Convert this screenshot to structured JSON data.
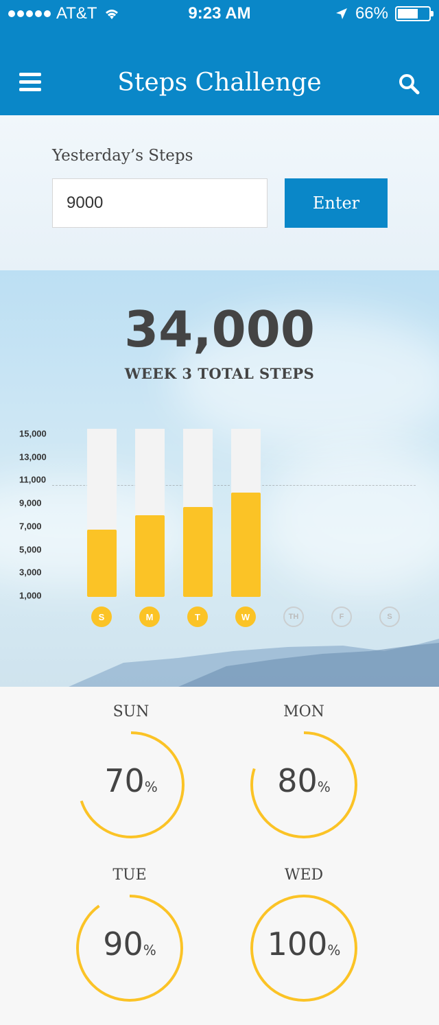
{
  "status_bar": {
    "carrier": "AT&T",
    "time": "9:23 AM",
    "battery": "66%",
    "battery_level": 0.66
  },
  "header": {
    "title": "Steps Challenge",
    "menu_icon": "hamburger-menu-icon",
    "search_icon": "search-icon"
  },
  "entry": {
    "label": "Yesterday’s Steps",
    "value": "9000",
    "button": "Enter"
  },
  "summary": {
    "total": "34,000",
    "caption": "WEEK 3 TOTAL STEPS"
  },
  "chart_data": {
    "type": "bar",
    "y_ticks": [
      "15,000",
      "13,000",
      "11,000",
      "9,000",
      "7,000",
      "5,000",
      "3,000",
      "1,000"
    ],
    "ylim": [
      0,
      15000
    ],
    "goal": 10000,
    "categories": [
      "S",
      "M",
      "T",
      "W",
      "TH",
      "F",
      "S"
    ],
    "values": [
      6000,
      7300,
      8000,
      9300,
      null,
      null,
      null
    ],
    "bar_color": "#fbc326",
    "track_color": "#f3f3f3"
  },
  "daily_progress": [
    {
      "day": "SUN",
      "percent": 70,
      "label": "70",
      "symbol": "%"
    },
    {
      "day": "MON",
      "percent": 80,
      "label": "80",
      "symbol": "%"
    },
    {
      "day": "TUE",
      "percent": 90,
      "label": "90",
      "symbol": "%"
    },
    {
      "day": "WED",
      "percent": 100,
      "label": "100",
      "symbol": "%"
    }
  ],
  "colors": {
    "brand": "#0a87c8",
    "accent": "#fbc326"
  }
}
